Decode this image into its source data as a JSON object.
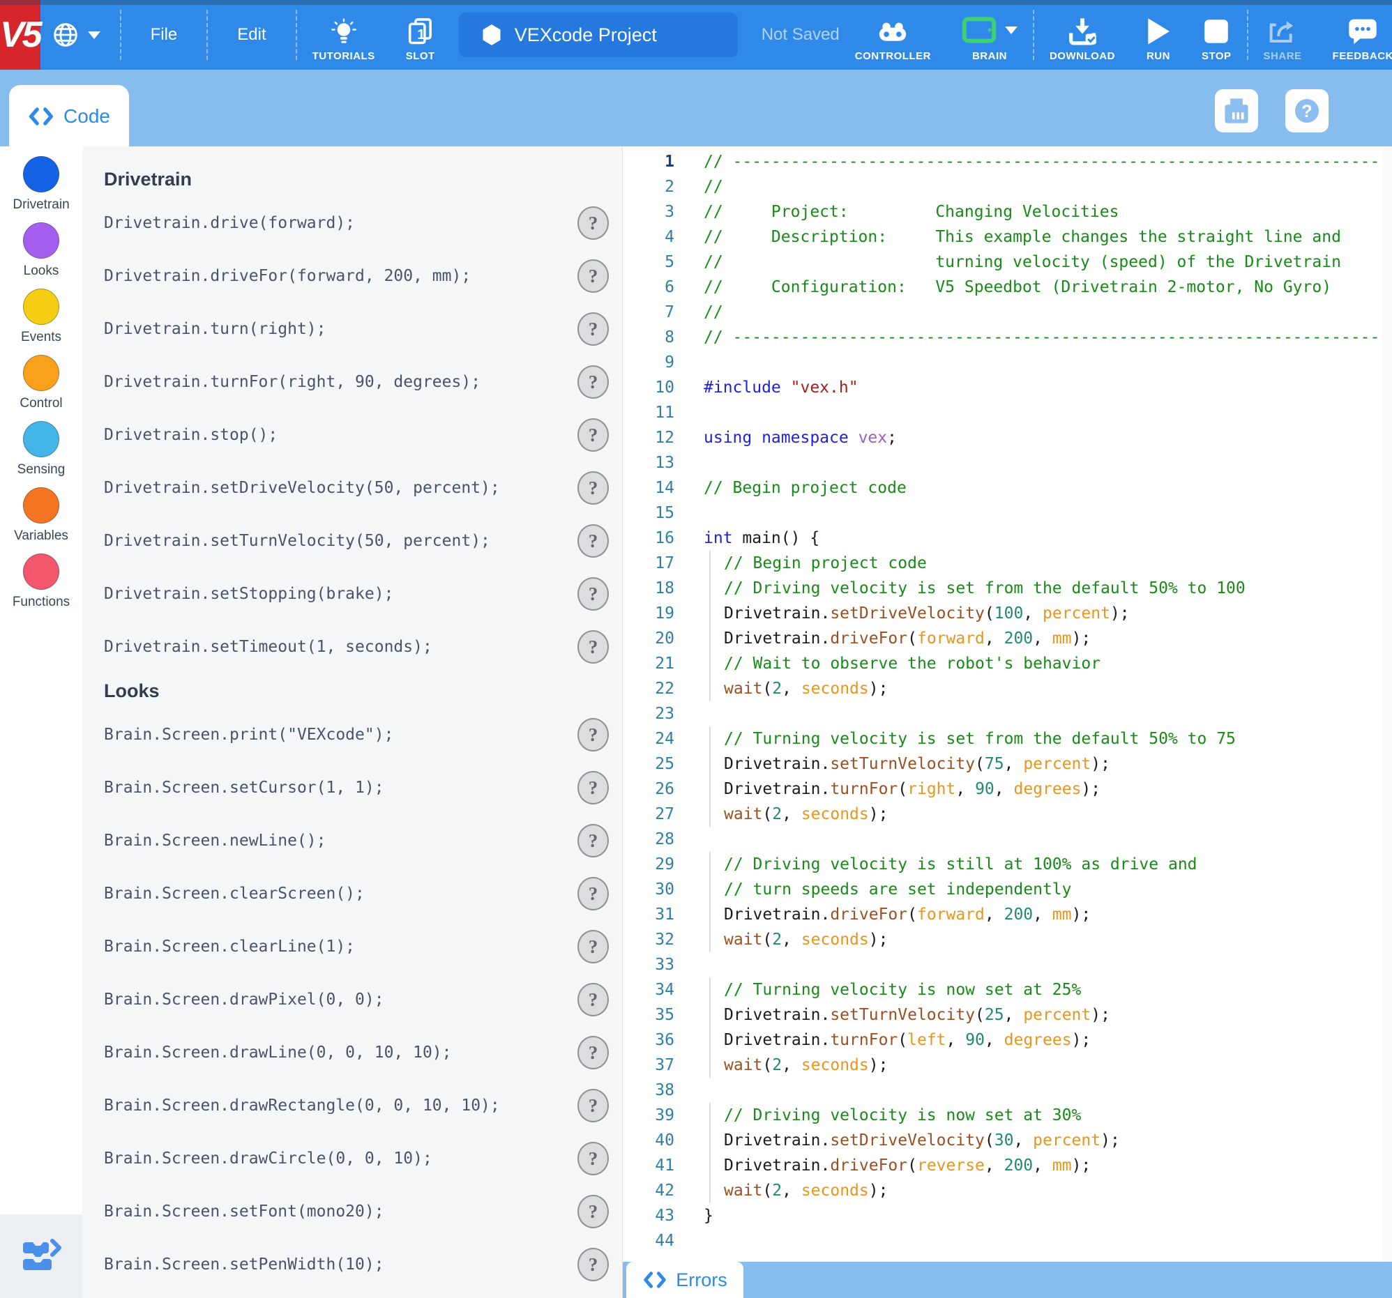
{
  "toolbar": {
    "logo_text": "V5",
    "menu_file": "File",
    "menu_edit": "Edit",
    "tutorials_label": "TUTORIALS",
    "slot_label": "SLOT",
    "slot_number": "1",
    "project_name": "VEXcode Project",
    "save_status": "Not Saved",
    "controller_label": "CONTROLLER",
    "brain_label": "BRAIN",
    "download_label": "DOWNLOAD",
    "run_label": "RUN",
    "stop_label": "STOP",
    "share_label": "SHARE",
    "feedback_label": "FEEDBACK"
  },
  "code_tab_label": "Code",
  "errors_tab_label": "Errors",
  "help_button_label": "?",
  "colors": {
    "toolbar_blue": "#2F89E8",
    "secondary_bar_blue": "#86BCEE",
    "vex_red": "#D6252B",
    "accent_blue": "#2E8AE8",
    "brain_green": "#3ECF7B",
    "panel_bg": "#F5F6F7",
    "syntax": {
      "comment": "#188A18",
      "keyword": "#2020DF",
      "string": "#A61D1D",
      "namespace": "#9A5FBF",
      "function": "#9B4F21",
      "number": "#1F8A70",
      "enum_param": "#E8951C",
      "plain": "#1B1B1B",
      "line_number": "#2F7FA6",
      "active_line_number": "#1D3E7A"
    }
  },
  "categories": [
    {
      "label": "Drivetrain",
      "color": "#1463E6"
    },
    {
      "label": "Looks",
      "color": "#A45FF0"
    },
    {
      "label": "Events",
      "color": "#F5CE13"
    },
    {
      "label": "Control",
      "color": "#F9A11B"
    },
    {
      "label": "Sensing",
      "color": "#43B5E8"
    },
    {
      "label": "Variables",
      "color": "#F47421"
    },
    {
      "label": "Functions",
      "color": "#F4566E"
    }
  ],
  "command_sections": [
    {
      "heading": "Drivetrain",
      "commands": [
        "Drivetrain.drive(forward);",
        "Drivetrain.driveFor(forward, 200, mm);",
        "Drivetrain.turn(right);",
        "Drivetrain.turnFor(right, 90, degrees);",
        "Drivetrain.stop();",
        "Drivetrain.setDriveVelocity(50, percent);",
        "Drivetrain.setTurnVelocity(50, percent);",
        "Drivetrain.setStopping(brake);",
        "Drivetrain.setTimeout(1, seconds);"
      ]
    },
    {
      "heading": "Looks",
      "commands": [
        "Brain.Screen.print(\"VEXcode\");",
        "Brain.Screen.setCursor(1, 1);",
        "Brain.Screen.newLine();",
        "Brain.Screen.clearScreen();",
        "Brain.Screen.clearLine(1);",
        "Brain.Screen.drawPixel(0, 0);",
        "Brain.Screen.drawLine(0, 0, 10, 10);",
        "Brain.Screen.drawRectangle(0, 0, 10, 10);",
        "Brain.Screen.drawCircle(0, 0, 10);",
        "Brain.Screen.setFont(mono20);",
        "Brain.Screen.setPenWidth(10);"
      ]
    }
  ],
  "editor": {
    "lines": [
      {
        "n": 1,
        "ind": false,
        "t": [
          [
            "c",
            "// ------------------------------------------------------------------------------------------------"
          ]
        ]
      },
      {
        "n": 2,
        "ind": false,
        "t": [
          [
            "c",
            "//"
          ]
        ]
      },
      {
        "n": 3,
        "ind": false,
        "t": [
          [
            "c",
            "//     Project:         Changing Velocities"
          ]
        ]
      },
      {
        "n": 4,
        "ind": false,
        "t": [
          [
            "c",
            "//     Description:     This example changes the straight line and"
          ]
        ]
      },
      {
        "n": 5,
        "ind": false,
        "t": [
          [
            "c",
            "//                      turning velocity (speed) of the Drivetrain"
          ]
        ]
      },
      {
        "n": 6,
        "ind": false,
        "t": [
          [
            "c",
            "//     Configuration:   V5 Speedbot (Drivetrain 2-motor, No Gyro)"
          ]
        ]
      },
      {
        "n": 7,
        "ind": false,
        "t": [
          [
            "c",
            "//"
          ]
        ]
      },
      {
        "n": 8,
        "ind": false,
        "t": [
          [
            "c",
            "// ------------------------------------------------------------------------------------------------"
          ]
        ]
      },
      {
        "n": 9,
        "ind": false,
        "t": []
      },
      {
        "n": 10,
        "ind": false,
        "t": [
          [
            "k",
            "#include"
          ],
          [
            "p",
            " "
          ],
          [
            "s",
            "\"vex.h\""
          ]
        ]
      },
      {
        "n": 11,
        "ind": false,
        "t": []
      },
      {
        "n": 12,
        "ind": false,
        "t": [
          [
            "k",
            "using namespace"
          ],
          [
            "p",
            " "
          ],
          [
            "ns",
            "vex"
          ],
          [
            "p",
            ";"
          ]
        ]
      },
      {
        "n": 13,
        "ind": false,
        "t": []
      },
      {
        "n": 14,
        "ind": false,
        "t": [
          [
            "c",
            "// Begin project code"
          ]
        ]
      },
      {
        "n": 15,
        "ind": false,
        "t": []
      },
      {
        "n": 16,
        "ind": false,
        "t": [
          [
            "k",
            "int"
          ],
          [
            "p",
            " main() {"
          ]
        ]
      },
      {
        "n": 17,
        "ind": true,
        "t": [
          [
            "c",
            "// Begin project code"
          ]
        ]
      },
      {
        "n": 18,
        "ind": true,
        "t": [
          [
            "c",
            "// Driving velocity is set from the default 50% to 100"
          ]
        ]
      },
      {
        "n": 19,
        "ind": true,
        "t": [
          [
            "p",
            "Drivetrain."
          ],
          [
            "f",
            "setDriveVelocity"
          ],
          [
            "p",
            "("
          ],
          [
            "n2",
            "100"
          ],
          [
            "p",
            ", "
          ],
          [
            "e",
            "percent"
          ],
          [
            "p",
            ");"
          ]
        ]
      },
      {
        "n": 20,
        "ind": true,
        "t": [
          [
            "p",
            "Drivetrain."
          ],
          [
            "f",
            "driveFor"
          ],
          [
            "p",
            "("
          ],
          [
            "e",
            "forward"
          ],
          [
            "p",
            ", "
          ],
          [
            "n2",
            "200"
          ],
          [
            "p",
            ", "
          ],
          [
            "e",
            "mm"
          ],
          [
            "p",
            ");"
          ]
        ]
      },
      {
        "n": 21,
        "ind": true,
        "t": [
          [
            "c",
            "// Wait to observe the robot's behavior"
          ]
        ]
      },
      {
        "n": 22,
        "ind": true,
        "t": [
          [
            "f",
            "wait"
          ],
          [
            "p",
            "("
          ],
          [
            "n2",
            "2"
          ],
          [
            "p",
            ", "
          ],
          [
            "e",
            "seconds"
          ],
          [
            "p",
            ");"
          ]
        ]
      },
      {
        "n": 23,
        "ind": false,
        "t": []
      },
      {
        "n": 24,
        "ind": true,
        "t": [
          [
            "c",
            "// Turning velocity is set from the default 50% to 75"
          ]
        ]
      },
      {
        "n": 25,
        "ind": true,
        "t": [
          [
            "p",
            "Drivetrain."
          ],
          [
            "f",
            "setTurnVelocity"
          ],
          [
            "p",
            "("
          ],
          [
            "n2",
            "75"
          ],
          [
            "p",
            ", "
          ],
          [
            "e",
            "percent"
          ],
          [
            "p",
            ");"
          ]
        ]
      },
      {
        "n": 26,
        "ind": true,
        "t": [
          [
            "p",
            "Drivetrain."
          ],
          [
            "f",
            "turnFor"
          ],
          [
            "p",
            "("
          ],
          [
            "e",
            "right"
          ],
          [
            "p",
            ", "
          ],
          [
            "n2",
            "90"
          ],
          [
            "p",
            ", "
          ],
          [
            "e",
            "degrees"
          ],
          [
            "p",
            ");"
          ]
        ]
      },
      {
        "n": 27,
        "ind": true,
        "t": [
          [
            "f",
            "wait"
          ],
          [
            "p",
            "("
          ],
          [
            "n2",
            "2"
          ],
          [
            "p",
            ", "
          ],
          [
            "e",
            "seconds"
          ],
          [
            "p",
            ");"
          ]
        ]
      },
      {
        "n": 28,
        "ind": false,
        "t": []
      },
      {
        "n": 29,
        "ind": true,
        "t": [
          [
            "c",
            "// Driving velocity is still at 100% as drive and"
          ]
        ]
      },
      {
        "n": 30,
        "ind": true,
        "t": [
          [
            "c",
            "// turn speeds are set independently"
          ]
        ]
      },
      {
        "n": 31,
        "ind": true,
        "t": [
          [
            "p",
            "Drivetrain."
          ],
          [
            "f",
            "driveFor"
          ],
          [
            "p",
            "("
          ],
          [
            "e",
            "forward"
          ],
          [
            "p",
            ", "
          ],
          [
            "n2",
            "200"
          ],
          [
            "p",
            ", "
          ],
          [
            "e",
            "mm"
          ],
          [
            "p",
            ");"
          ]
        ]
      },
      {
        "n": 32,
        "ind": true,
        "t": [
          [
            "f",
            "wait"
          ],
          [
            "p",
            "("
          ],
          [
            "n2",
            "2"
          ],
          [
            "p",
            ", "
          ],
          [
            "e",
            "seconds"
          ],
          [
            "p",
            ");"
          ]
        ]
      },
      {
        "n": 33,
        "ind": false,
        "t": []
      },
      {
        "n": 34,
        "ind": true,
        "t": [
          [
            "c",
            "// Turning velocity is now set at 25%"
          ]
        ]
      },
      {
        "n": 35,
        "ind": true,
        "t": [
          [
            "p",
            "Drivetrain."
          ],
          [
            "f",
            "setTurnVelocity"
          ],
          [
            "p",
            "("
          ],
          [
            "n2",
            "25"
          ],
          [
            "p",
            ", "
          ],
          [
            "e",
            "percent"
          ],
          [
            "p",
            ");"
          ]
        ]
      },
      {
        "n": 36,
        "ind": true,
        "t": [
          [
            "p",
            "Drivetrain."
          ],
          [
            "f",
            "turnFor"
          ],
          [
            "p",
            "("
          ],
          [
            "e",
            "left"
          ],
          [
            "p",
            ", "
          ],
          [
            "n2",
            "90"
          ],
          [
            "p",
            ", "
          ],
          [
            "e",
            "degrees"
          ],
          [
            "p",
            ");"
          ]
        ]
      },
      {
        "n": 37,
        "ind": true,
        "t": [
          [
            "f",
            "wait"
          ],
          [
            "p",
            "("
          ],
          [
            "n2",
            "2"
          ],
          [
            "p",
            ", "
          ],
          [
            "e",
            "seconds"
          ],
          [
            "p",
            ");"
          ]
        ]
      },
      {
        "n": 38,
        "ind": false,
        "t": []
      },
      {
        "n": 39,
        "ind": true,
        "t": [
          [
            "c",
            "// Driving velocity is now set at 30%"
          ]
        ]
      },
      {
        "n": 40,
        "ind": true,
        "t": [
          [
            "p",
            "Drivetrain."
          ],
          [
            "f",
            "setDriveVelocity"
          ],
          [
            "p",
            "("
          ],
          [
            "n2",
            "30"
          ],
          [
            "p",
            ", "
          ],
          [
            "e",
            "percent"
          ],
          [
            "p",
            ");"
          ]
        ]
      },
      {
        "n": 41,
        "ind": true,
        "t": [
          [
            "p",
            "Drivetrain."
          ],
          [
            "f",
            "driveFor"
          ],
          [
            "p",
            "("
          ],
          [
            "e",
            "reverse"
          ],
          [
            "p",
            ", "
          ],
          [
            "n2",
            "200"
          ],
          [
            "p",
            ", "
          ],
          [
            "e",
            "mm"
          ],
          [
            "p",
            ");"
          ]
        ]
      },
      {
        "n": 42,
        "ind": true,
        "t": [
          [
            "f",
            "wait"
          ],
          [
            "p",
            "("
          ],
          [
            "n2",
            "2"
          ],
          [
            "p",
            ", "
          ],
          [
            "e",
            "seconds"
          ],
          [
            "p",
            ");"
          ]
        ]
      },
      {
        "n": 43,
        "ind": false,
        "t": [
          [
            "p",
            "}"
          ]
        ]
      },
      {
        "n": 44,
        "ind": false,
        "t": []
      }
    ]
  }
}
